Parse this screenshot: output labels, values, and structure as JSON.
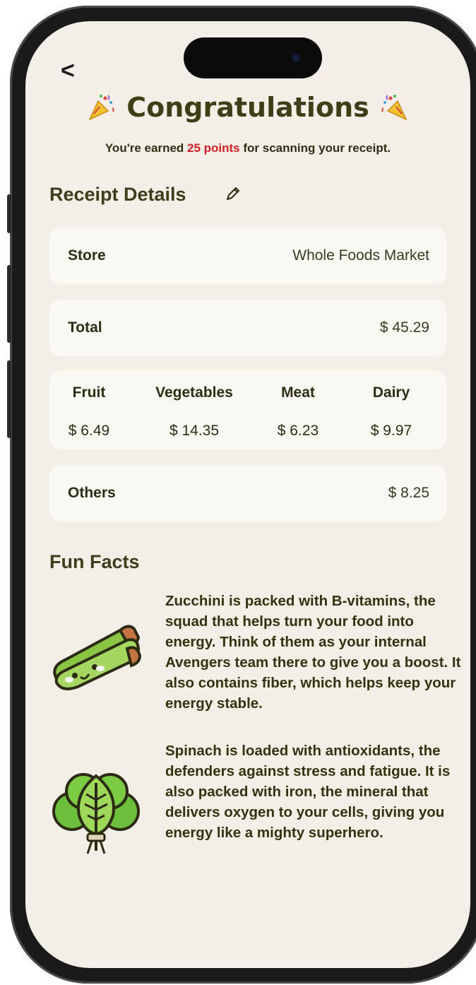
{
  "nav": {
    "back_label": "<"
  },
  "header": {
    "title": "Congratulations",
    "subtitle_prefix": "You're earned ",
    "subtitle_points": "25 points",
    "subtitle_suffix": " for scanning your receipt."
  },
  "receipt": {
    "section_title": "Receipt Details",
    "store": {
      "label": "Store",
      "value": "Whole Foods Market"
    },
    "total": {
      "label": "Total",
      "value": "$ 45.29"
    },
    "categories": [
      {
        "name": "Fruit",
        "amount": "$ 6.49"
      },
      {
        "name": "Vegetables",
        "amount": "$ 14.35"
      },
      {
        "name": "Meat",
        "amount": "$ 6.23"
      },
      {
        "name": "Dairy",
        "amount": "$ 9.97"
      }
    ],
    "others": {
      "label": "Others",
      "value": "$ 8.25"
    }
  },
  "fun_facts": {
    "section_title": "Fun Facts",
    "items": [
      {
        "icon": "zucchini-icon",
        "text": "Zucchini is packed with B-vitamins, the squad that helps turn your food into energy. Think of them as your internal Avengers team there to give you a boost. It also contains fiber, which helps keep your energy stable."
      },
      {
        "icon": "spinach-icon",
        "text": "Spinach is loaded with antioxidants, the defenders against stress and fatigue. It is also packed with iron, the mineral that delivers oxygen to your cells, giving you energy like a mighty superhero."
      }
    ]
  },
  "colors": {
    "background": "#f3efe7",
    "card": "#faf8f3",
    "title_olive": "#3c3f17",
    "points_red": "#d01f26"
  }
}
